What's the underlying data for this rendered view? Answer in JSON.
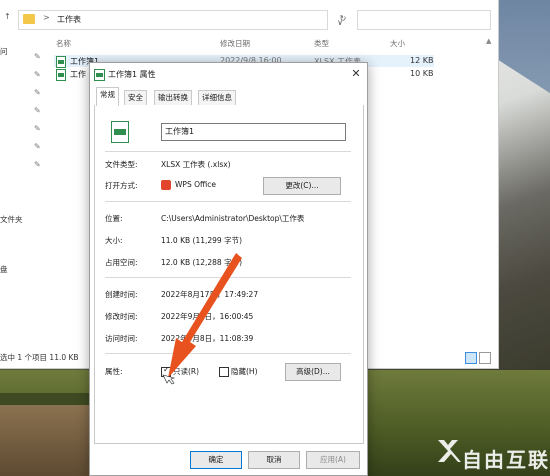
{
  "explorer": {
    "breadcrumb_sep": ">",
    "address_text": "工作表",
    "dropdown_glyph": "∨",
    "refresh_glyph": "↻",
    "columns": {
      "name": "名称",
      "date": "修改日期",
      "type": "类型",
      "size": "大小"
    },
    "files": [
      {
        "name": "工作簿1",
        "date": "2022/9/8 16:00",
        "type": "XLSX 工作表",
        "size": "12 KB",
        "selected": true
      },
      {
        "name": "工作",
        "date": "",
        "type": "",
        "size": "10 KB",
        "selected": false
      }
    ],
    "nav_labels": [
      "问",
      "文件夹",
      "盘"
    ],
    "status_text": "选中 1 个项目  11.0 KB"
  },
  "dialog": {
    "title": "工作簿1 属性",
    "close_glyph": "✕",
    "tabs": [
      "常规",
      "安全",
      "输出转换",
      "详细信息"
    ],
    "active_tab": "常规",
    "file_name": "工作簿1",
    "rows": [
      {
        "label": "文件类型:",
        "value": "XLSX 工作表 (.xlsx)"
      },
      {
        "label": "打开方式:",
        "value": "WPS Office"
      },
      {
        "label": "位置:",
        "value": "C:\\Users\\Administrator\\Desktop\\工作表"
      },
      {
        "label": "大小:",
        "value": "11.0 KB (11,299 字节)"
      },
      {
        "label": "占用空间:",
        "value": "12.0 KB (12,288 字节)"
      },
      {
        "label": "创建时间:",
        "value": "2022年8月17日，17:49:27"
      },
      {
        "label": "修改时间:",
        "value": "2022年9月8日，16:00:45"
      },
      {
        "label": "访问时间:",
        "value": "2022年9月8日，11:08:39"
      }
    ],
    "change_button": "更改(C)...",
    "attributes_label": "属性:",
    "readonly_label": "只读(R)",
    "readonly_checked": true,
    "hidden_label": "隐藏(H)",
    "hidden_checked": false,
    "advanced_button": "高级(D)...",
    "ok_button": "确定",
    "cancel_button": "取消",
    "apply_button": "应用(A)"
  },
  "watermark": "自由互联",
  "colors": {
    "accent": "#0078d7",
    "arrow": "#e8521f",
    "excel_green": "#2f8f4e",
    "wps_red": "#e2452c"
  }
}
